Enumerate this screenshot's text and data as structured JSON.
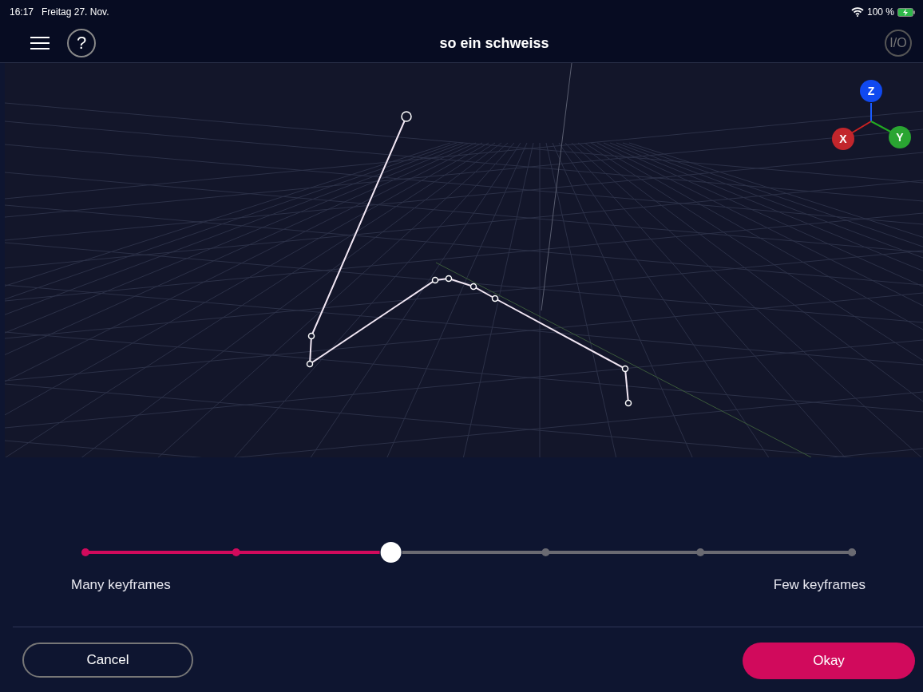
{
  "status_bar": {
    "time": "16:17",
    "date": "Freitag 27. Nov.",
    "battery": "100 %"
  },
  "header": {
    "title": "so ein schweiss",
    "io_button": "I/O",
    "help_button": "?"
  },
  "axis_gizmo": {
    "z": "Z",
    "x": "X",
    "y": "Y"
  },
  "slider": {
    "level": 0.4,
    "min_label": "Many keyframes",
    "max_label": "Few keyframes"
  },
  "buttons": {
    "cancel": "Cancel",
    "okay": "Okay"
  }
}
